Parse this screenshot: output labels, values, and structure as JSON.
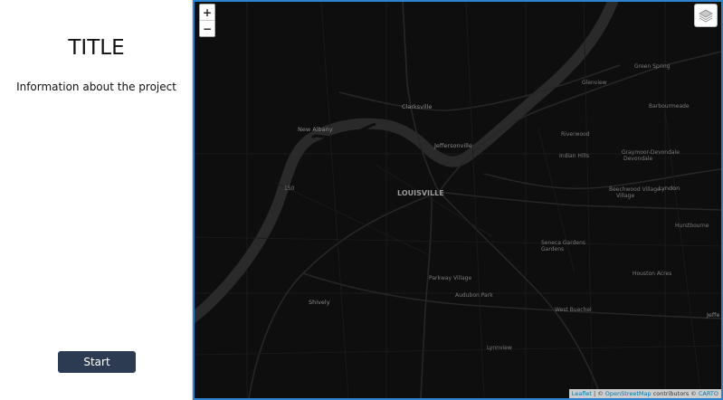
{
  "sidebar": {
    "title": "TITLE",
    "info": "Information about the project",
    "start_label": "Start"
  },
  "map": {
    "zoom_in": "+",
    "zoom_out": "−",
    "layers_icon": "layers-icon",
    "attribution": {
      "leaflet": "Leaflet",
      "sep": " | © ",
      "osm": "OpenStreetMap",
      "contributors": " contributors © ",
      "carto": "CARTO"
    },
    "labels": {
      "green_spring": "Green Spring",
      "glenview": "Glenview",
      "barbourmeade": "Barbourmeade",
      "clarksville": "Clarksville",
      "new_albany": "New Albany",
      "jeffersonville": "Jeffersonville",
      "riverwood": "Riverwood",
      "indian_hills": "Indian Hills",
      "graymoor_devondale": "Graymoor-Devondale",
      "louisville": "LOUISVILLE",
      "beechwood_village": "Beechwood Village",
      "lyndon": "Lyndon",
      "hurstbourne": "Hurstbourne",
      "seneca_gardens": "Seneca Gardens",
      "houston_acres": "Houston Acres",
      "parkway_village": "Parkway Village",
      "audubon_park": "Audubon Park",
      "shively": "Shively",
      "west_buechel": "West Buechel",
      "jeffe": "Jeffe",
      "lynnview": "Lynnview",
      "route": "150"
    }
  },
  "colors": {
    "map_bg": "#0e0e0f",
    "river": "#2a2a2b",
    "border": "#2e82d0",
    "button": "#2c3a52"
  }
}
